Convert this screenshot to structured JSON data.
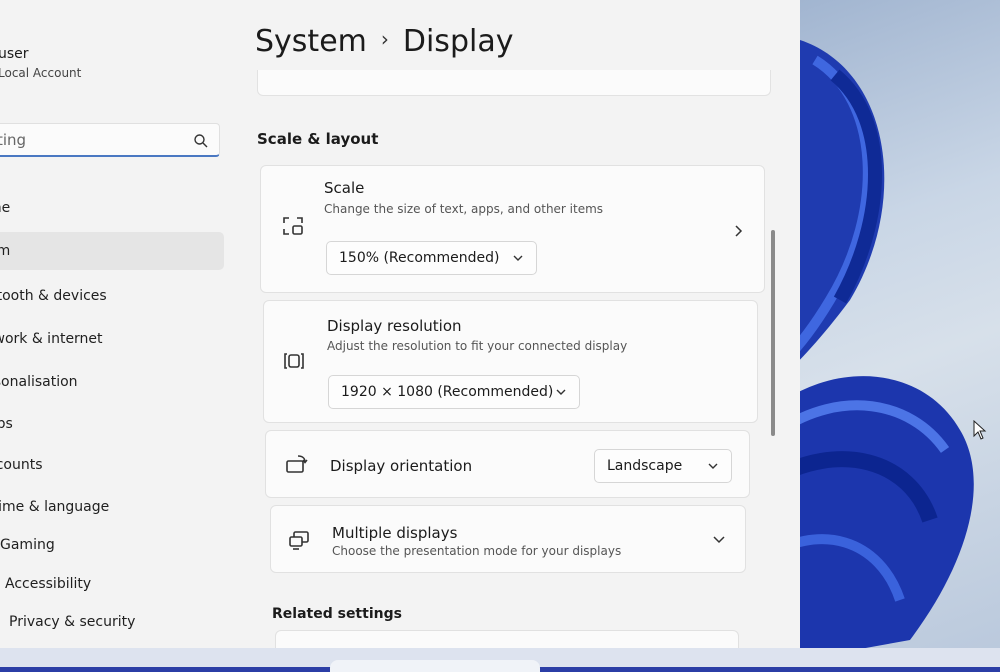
{
  "sidebar": {
    "user": {
      "name": "user",
      "account_type": "Local Account"
    },
    "search": {
      "value": "ting"
    },
    "items": [
      {
        "label": "me"
      },
      {
        "label": "em"
      },
      {
        "label": "etooth & devices"
      },
      {
        "label": "twork & internet"
      },
      {
        "label": "rsonalisation"
      },
      {
        "label": "ops"
      },
      {
        "label": "ccounts"
      },
      {
        "label": "Time & language"
      },
      {
        "label": "Gaming"
      },
      {
        "label": "Accessibility"
      },
      {
        "label": "Privacy & security"
      }
    ]
  },
  "header": {
    "parent": "System",
    "separator": "›",
    "title": "Display"
  },
  "scale_layout": {
    "section_title": "Scale & layout",
    "scale": {
      "title": "Scale",
      "description": "Change the size of text, apps, and other items",
      "value": "150% (Recommended)",
      "icon": "scale-icon"
    },
    "resolution": {
      "title": "Display resolution",
      "description": "Adjust the resolution to fit your connected display",
      "value": "1920 × 1080 (Recommended)",
      "icon": "resolution-icon"
    },
    "orientation": {
      "title": "Display orientation",
      "value": "Landscape",
      "icon": "orientation-icon"
    },
    "multiple": {
      "title": "Multiple displays",
      "description": "Choose the presentation mode for your displays",
      "icon": "multiple-displays-icon"
    }
  },
  "related": {
    "section_title": "Related settings"
  },
  "colors": {
    "accent": "#4a78c2",
    "window_bg": "#f3f3f3",
    "card_bg": "#fbfbfb"
  }
}
